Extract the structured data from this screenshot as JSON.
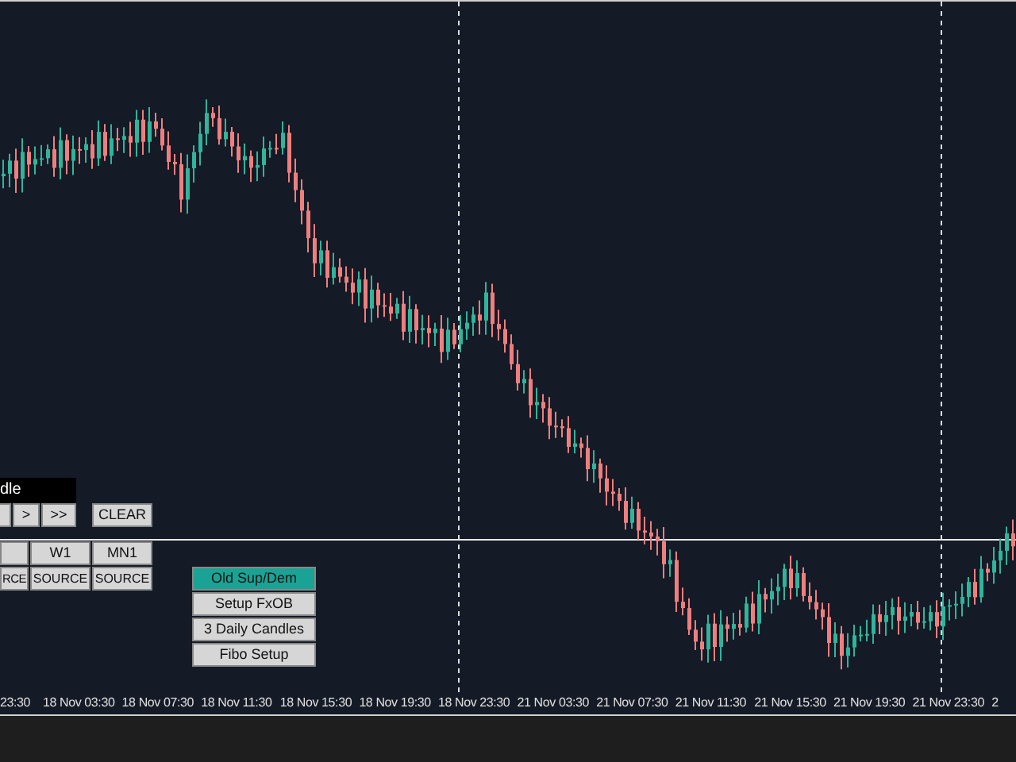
{
  "chart": {
    "time_axis": [
      "23:30",
      "18 Nov 03:30",
      "18 Nov 07:30",
      "18 Nov 11:30",
      "18 Nov 15:30",
      "18 Nov 19:30",
      "18 Nov 23:30",
      "21 Nov 03:30",
      "21 Nov 07:30",
      "21 Nov 11:30",
      "21 Nov 15:30",
      "21 Nov 19:30",
      "21 Nov 23:30",
      "2"
    ]
  },
  "panel": {
    "title": "dle",
    "nav_buttons": [
      ">",
      ">>"
    ],
    "clear_button": "CLEAR",
    "timeframes": [
      {
        "source": "RCE"
      },
      {
        "label": "W1",
        "source": "SOURCE"
      },
      {
        "label": "MN1",
        "source": "SOURCE"
      }
    ]
  },
  "menu": [
    {
      "label": "Old Sup/Dem",
      "selected": true
    },
    {
      "label": "Setup FxOB",
      "selected": false
    },
    {
      "label": "3 Daily Candles",
      "selected": false
    },
    {
      "label": "Fibo Setup",
      "selected": false
    }
  ]
}
